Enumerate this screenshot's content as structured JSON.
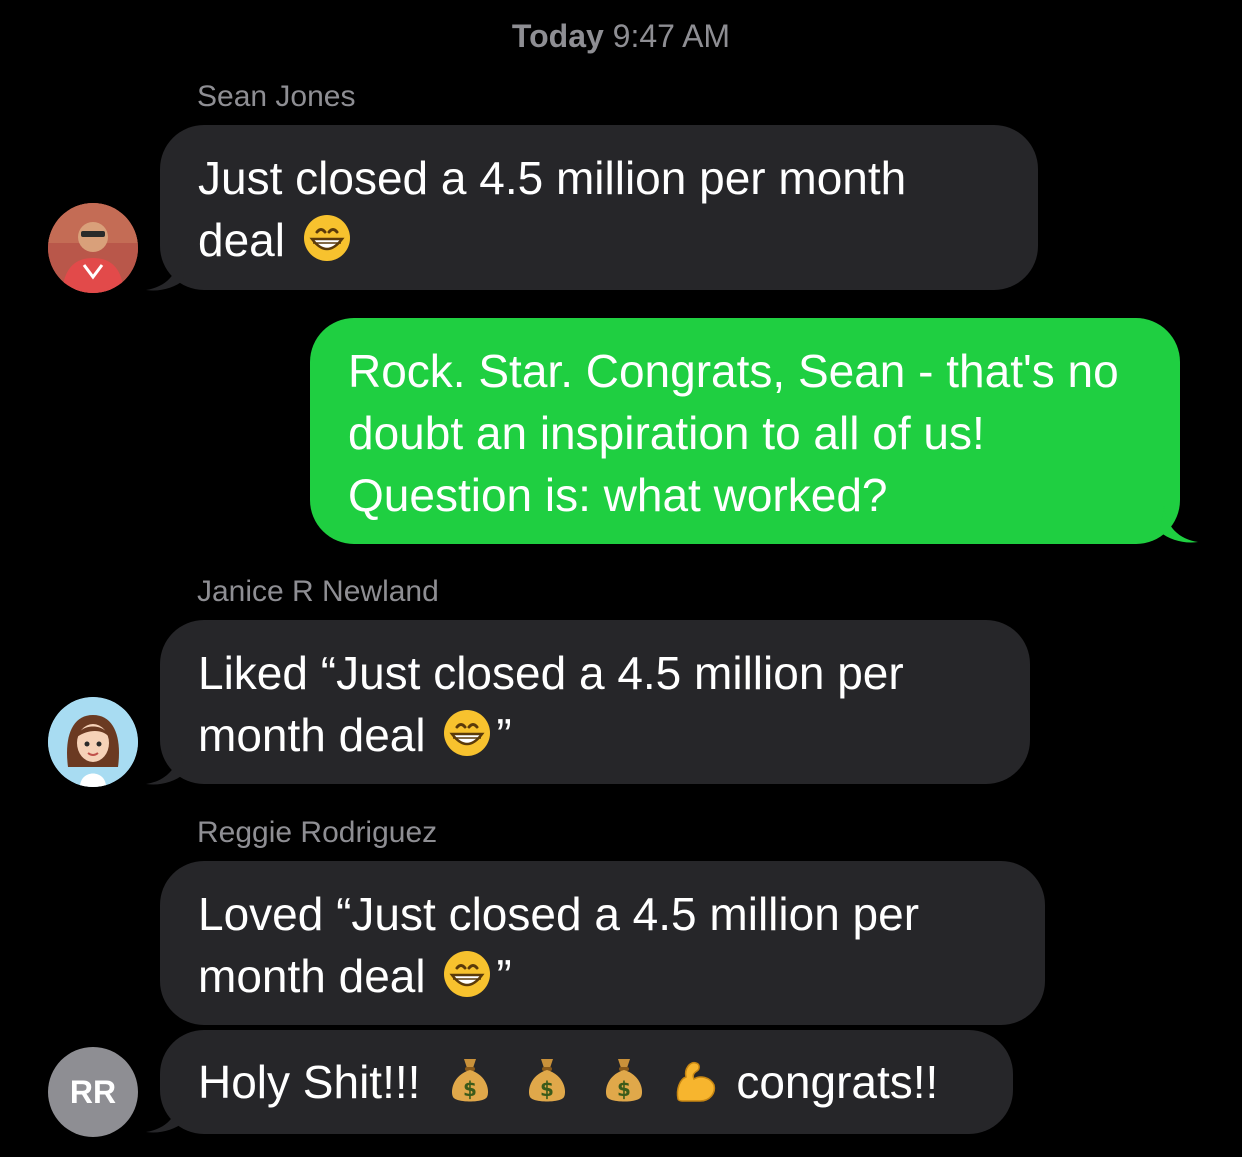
{
  "conversation": {
    "timestamp_day": "Today",
    "timestamp_time": "9:47 AM",
    "messages": [
      {
        "sender": "Sean Jones",
        "text_before": "Just closed a 4.5 million per month deal",
        "emoji": "grinning-face"
      },
      {
        "sender": "me",
        "text": "Rock. Star. Congrats, Sean - that's no doubt an inspiration to all of us! Question is: what worked?"
      },
      {
        "sender": "Janice R Newland",
        "text_before": "Liked “Just closed a 4.5 million per month deal",
        "emoji": "grinning-face",
        "text_after": "”"
      },
      {
        "sender": "Reggie Rodriguez",
        "text_before": "Loved “Just closed a 4.5 million per month deal",
        "emoji": "grinning-face",
        "text_after": "”"
      },
      {
        "sender": "Reggie Rodriguez",
        "text_before": "Holy Shit!!!",
        "emojis": [
          "money-bag",
          "money-bag",
          "money-bag",
          "flexed-biceps"
        ],
        "text_after": "congrats!!"
      }
    ],
    "avatars": {
      "reggie_initials": "RR"
    }
  },
  "colors": {
    "background": "#000000",
    "incoming_bubble": "#262629",
    "outgoing_bubble": "#1fcf41",
    "meta_text": "#8e8e93"
  }
}
